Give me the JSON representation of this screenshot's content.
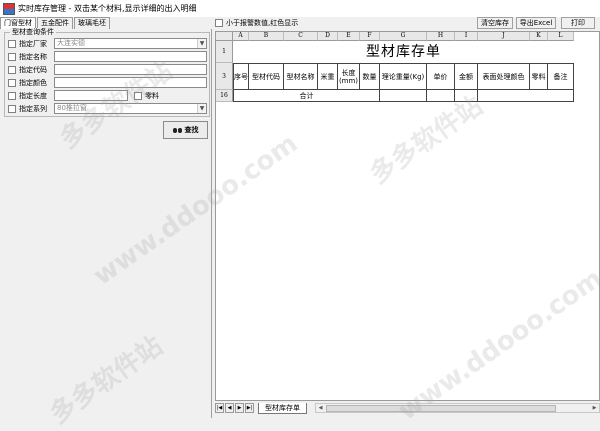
{
  "window": {
    "title": "实时库存管理 - 双击某个材料,显示详细的出入明细"
  },
  "tabs": [
    {
      "label": "门窗型材"
    },
    {
      "label": "五金配件"
    },
    {
      "label": "玻璃毛坯"
    }
  ],
  "query": {
    "group_title": "型材查询条件",
    "fields": [
      {
        "label": "指定厂家",
        "value": "大连实德",
        "type": "select"
      },
      {
        "label": "指定名称",
        "value": "",
        "type": "text"
      },
      {
        "label": "指定代码",
        "value": "",
        "type": "text"
      },
      {
        "label": "指定颜色",
        "value": "",
        "type": "text"
      },
      {
        "label": "指定长度",
        "value": "",
        "type": "text",
        "extra_checkbox": "零料"
      },
      {
        "label": "指定系列",
        "value": "80推拉窗",
        "type": "select"
      }
    ],
    "search_label": "查找"
  },
  "toolbar": {
    "alarm_checkbox": "小于报警数值,红色显示",
    "clear_stock": "清空库存",
    "export_excel": "导出Excel",
    "print": "打印"
  },
  "sheet": {
    "title": "型材库存单",
    "columns": [
      "A",
      "B",
      "C",
      "D",
      "E",
      "F",
      "G",
      "H",
      "I",
      "J",
      "K",
      "L"
    ],
    "row_numbers": [
      "1",
      "3",
      "16"
    ],
    "headers": [
      "序号",
      "型材代码",
      "型材名称",
      "米重",
      "长度(mm)",
      "数量",
      "理论重量(Kg)",
      "单价",
      "金额",
      "表面处理颜色",
      "零料",
      "备注"
    ],
    "total_label": "合计",
    "sheet_tab": "型材库存单"
  },
  "watermark": [
    "多多软件站",
    "www.ddooo.com"
  ]
}
